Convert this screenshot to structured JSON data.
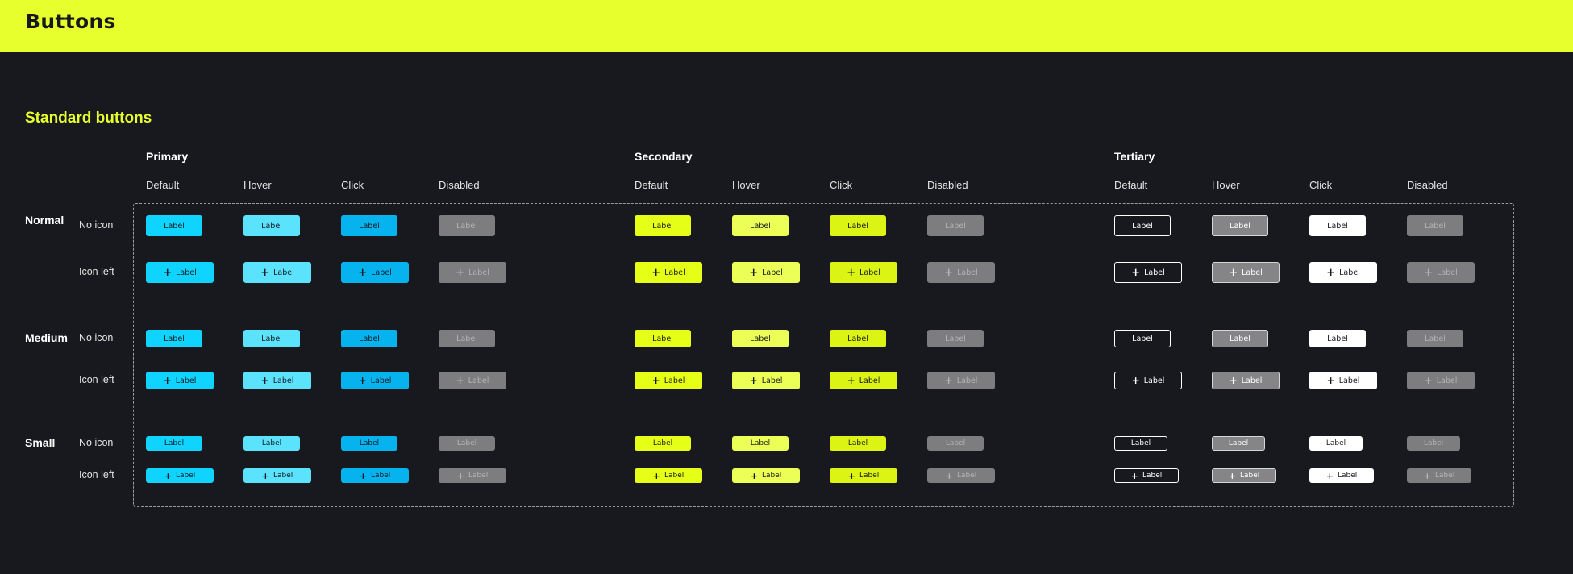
{
  "page": {
    "title": "Buttons",
    "section_title": "Standard buttons"
  },
  "colors": {
    "accent": "#e6ff2d",
    "background": "#18191e"
  },
  "groups": [
    {
      "id": "primary",
      "title": "Primary",
      "states": [
        {
          "id": "default",
          "label": "Default",
          "bg": "#0fd4ff",
          "border": "#0fd4ff",
          "text": "#18191e"
        },
        {
          "id": "hover",
          "label": "Hover",
          "bg": "#5be2fd",
          "border": "#5be2fd",
          "text": "#18191e"
        },
        {
          "id": "click",
          "label": "Click",
          "bg": "#06b3ef",
          "border": "#06b3ef",
          "text": "#18191e"
        },
        {
          "id": "disabled",
          "label": "Disabled",
          "bg": "#7d7d7f",
          "border": "#7d7d7f",
          "text": "#b4b4b4"
        }
      ]
    },
    {
      "id": "secondary",
      "title": "Secondary",
      "states": [
        {
          "id": "default",
          "label": "Default",
          "bg": "#e6ff16",
          "border": "#e6ff16",
          "text": "#18191e"
        },
        {
          "id": "hover",
          "label": "Hover",
          "bg": "#ebff57",
          "border": "#ebff57",
          "text": "#18191e"
        },
        {
          "id": "click",
          "label": "Click",
          "bg": "#dcf413",
          "border": "#dcf413",
          "text": "#18191e"
        },
        {
          "id": "disabled",
          "label": "Disabled",
          "bg": "#7d7d7f",
          "border": "#7d7d7f",
          "text": "#b4b4b4"
        }
      ]
    },
    {
      "id": "tertiary",
      "title": "Tertiary",
      "states": [
        {
          "id": "default",
          "label": "Default",
          "bg": "transparent",
          "border": "#ffffff",
          "text": "#ffffff"
        },
        {
          "id": "hover",
          "label": "Hover",
          "bg": "#858587",
          "border": "#d6d6d6",
          "text": "#ffffff"
        },
        {
          "id": "click",
          "label": "Click",
          "bg": "#ffffff",
          "border": "#ffffff",
          "text": "#18191e"
        },
        {
          "id": "disabled",
          "label": "Disabled",
          "bg": "#7d7d7f",
          "border": "#7d7d7f",
          "text": "#b4b4b4"
        }
      ]
    }
  ],
  "sizes": [
    {
      "id": "normal",
      "label": "Normal",
      "rows": [
        {
          "id": "no-icon",
          "label": "No icon",
          "icon": false,
          "button_label": "Label"
        },
        {
          "id": "icon-left",
          "label": "Icon left",
          "icon": true,
          "button_label": "Label"
        }
      ]
    },
    {
      "id": "medium",
      "label": "Medium",
      "rows": [
        {
          "id": "no-icon",
          "label": "No icon",
          "icon": false,
          "button_label": "Label"
        },
        {
          "id": "icon-left",
          "label": "Icon left",
          "icon": true,
          "button_label": "Label"
        }
      ]
    },
    {
      "id": "small",
      "label": "Small",
      "rows": [
        {
          "id": "no-icon",
          "label": "No icon",
          "icon": false,
          "button_label": "Label"
        },
        {
          "id": "icon-left",
          "label": "Icon left",
          "icon": true,
          "button_label": "Label"
        }
      ]
    }
  ]
}
